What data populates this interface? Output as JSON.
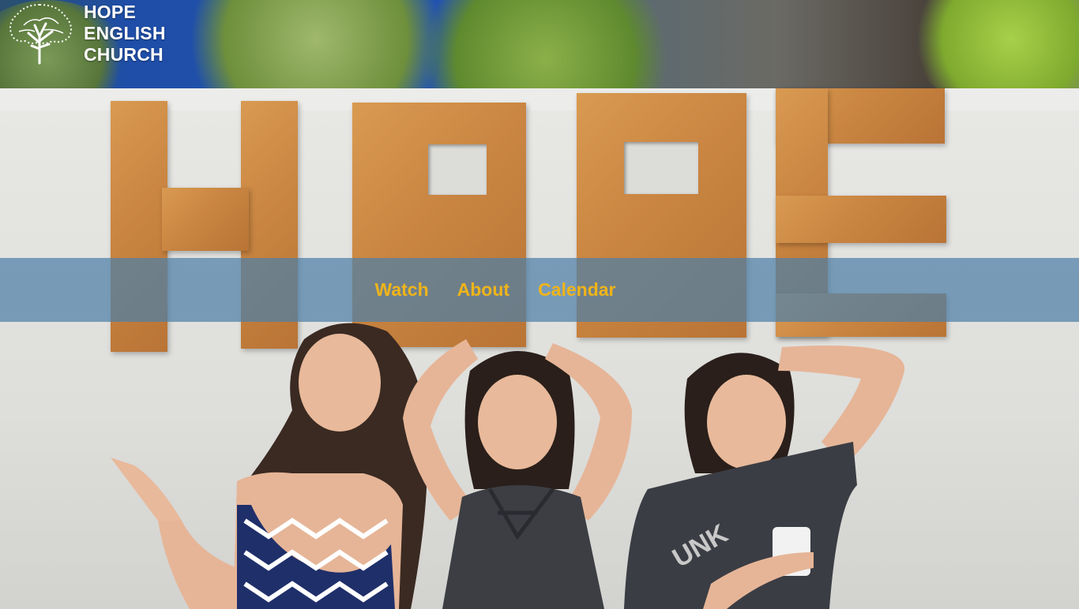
{
  "brand": {
    "name_line1": "HOPE",
    "name_line2": "ENGLISH",
    "name_line3": "CHURCH",
    "logo_icon": "tree-icon"
  },
  "nav": {
    "items": [
      {
        "label": "Watch"
      },
      {
        "label": "About"
      },
      {
        "label": "Calendar"
      }
    ],
    "link_color": "#f0b41a",
    "band_color": "#4e80a8"
  },
  "hero": {
    "image_subject": "three-girls-under-wooden-hope-letters"
  }
}
